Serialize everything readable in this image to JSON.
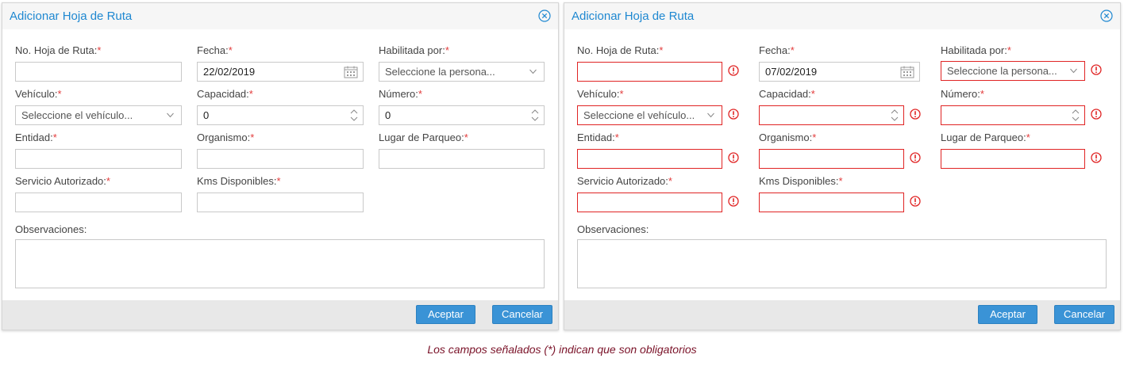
{
  "dialog_title": "Adicionar Hoja de Ruta",
  "labels": {
    "no_hoja": "No. Hoja de Ruta:",
    "fecha": "Fecha:",
    "habilitada": "Habilitada por:",
    "vehiculo": "Vehículo:",
    "capacidad": "Capacidad:",
    "numero": "Número:",
    "entidad": "Entidad:",
    "organismo": "Organismo:",
    "lugar": "Lugar de Parqueo:",
    "servicio": "Servicio Autorizado:",
    "kms": "Kms Disponibles:",
    "observaciones": "Observaciones:"
  },
  "required_mark": "*",
  "placeholders": {
    "persona": "Seleccione la persona...",
    "vehiculo": "Seleccione el vehículo..."
  },
  "form1": {
    "fecha": "22/02/2019",
    "capacidad": "0",
    "numero": "0"
  },
  "form2": {
    "fecha": "07/02/2019",
    "capacidad": "",
    "numero": ""
  },
  "buttons": {
    "accept": "Aceptar",
    "cancel": "Cancelar"
  },
  "footnote": "Los campos señalados (*) indican que son obligatorios",
  "colors": {
    "title": "#1f88d1",
    "button": "#3a93d6",
    "required": "#e23b3b",
    "error_border": "#e02424",
    "footnote": "#7a1228"
  },
  "icons": [
    "close-icon",
    "calendar-icon",
    "chevron-down-icon",
    "spinner-icon",
    "error-icon"
  ]
}
